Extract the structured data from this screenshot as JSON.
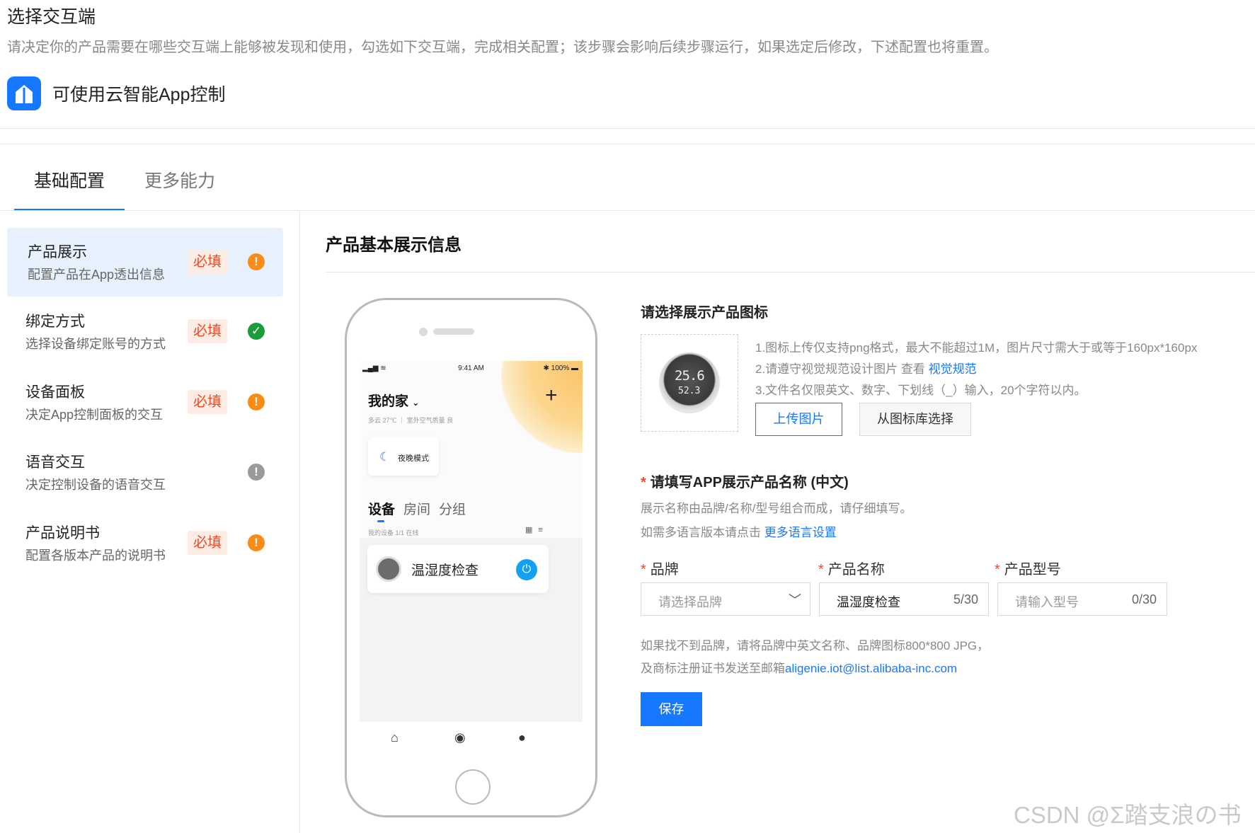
{
  "header": {
    "title": "选择交互端",
    "description": "请决定你的产品需要在哪些交互端上能够被发现和使用，勾选如下交互端，完成相关配置；该步骤会影响后续步骤运行，如果选定后修改，下述配置也将重置。",
    "app_name": "可使用云智能App控制",
    "app_icon": "house-icon"
  },
  "tabs": [
    {
      "label": "基础配置",
      "active": true
    },
    {
      "label": "更多能力",
      "active": false
    }
  ],
  "sidebar": {
    "items": [
      {
        "title": "产品展示",
        "subtitle": "配置产品在App透出信息",
        "tag": "必填",
        "status": "warning",
        "status_glyph": "!",
        "active": true
      },
      {
        "title": "绑定方式",
        "subtitle": "选择设备绑定账号的方式",
        "tag": "必填",
        "status": "done",
        "status_glyph": "✓",
        "active": false
      },
      {
        "title": "设备面板",
        "subtitle": "决定App控制面板的交互",
        "tag": "必填",
        "status": "warning",
        "status_glyph": "!",
        "active": false
      },
      {
        "title": "语音交互",
        "subtitle": "决定控制设备的语音交互",
        "tag": "",
        "status": "optional",
        "status_glyph": "!",
        "active": false
      },
      {
        "title": "产品说明书",
        "subtitle": "配置各版本产品的说明书",
        "tag": "必填",
        "status": "warning",
        "status_glyph": "!",
        "active": false
      }
    ]
  },
  "main": {
    "title": "产品基本展示信息"
  },
  "phone": {
    "status_time": "9:41 AM",
    "status_battery": "100%",
    "home_name": "我的家",
    "weather": "多云 27℃ ｜ 室外空气质量 良",
    "night_mode": "夜晚模式",
    "device_tabs": [
      "设备",
      "房间",
      "分组"
    ],
    "device_count": "我的设备   1/1 在线",
    "device_name": "温湿度检查"
  },
  "icon_section": {
    "title": "请选择展示产品图标",
    "gauge_top": "25.6",
    "gauge_bottom": "52.3",
    "rule1": "1.图标上传仅支持png格式，最大不能超过1M，图片尺寸需大于或等于160px*160px",
    "rule2_prefix": "2.请遵守视觉规范设计图片 查看",
    "rule2_link": "视觉规范",
    "rule3": "3.文件名仅限英文、数字、下划线（_）输入，20个字符以内。",
    "upload_button": "上传图片",
    "library_button": "从图标库选择"
  },
  "name_section": {
    "title": "请填写APP展示产品名称 (中文)",
    "hint1": "展示名称由品牌/名称/型号组合而成，请仔细填写。",
    "hint2_prefix": "如需多语言版本请点击",
    "hint2_link": "更多语言设置",
    "brand_label": "品牌",
    "brand_placeholder": "请选择品牌",
    "product_label": "产品名称",
    "product_value": "温湿度检查",
    "product_count": "5/30",
    "model_label": "产品型号",
    "model_placeholder": "请输入型号",
    "model_count": "0/30",
    "footer1": "如果找不到品牌，请将品牌中英文名称、品牌图标800*800 JPG，",
    "footer2_prefix": "及商标注册证书发送至邮箱",
    "footer2_email": "aligenie.iot@list.alibaba-inc.com",
    "save_button": "保存"
  },
  "watermark": "CSDN @Σ踏支浪の书",
  "colors": {
    "accent": "#1677ff",
    "required_tag_bg": "#fdece4",
    "required_tag_text": "#f04a24",
    "warning": "#fa8c16",
    "success": "#1a9c3a",
    "neutral": "#9a9a9a"
  }
}
